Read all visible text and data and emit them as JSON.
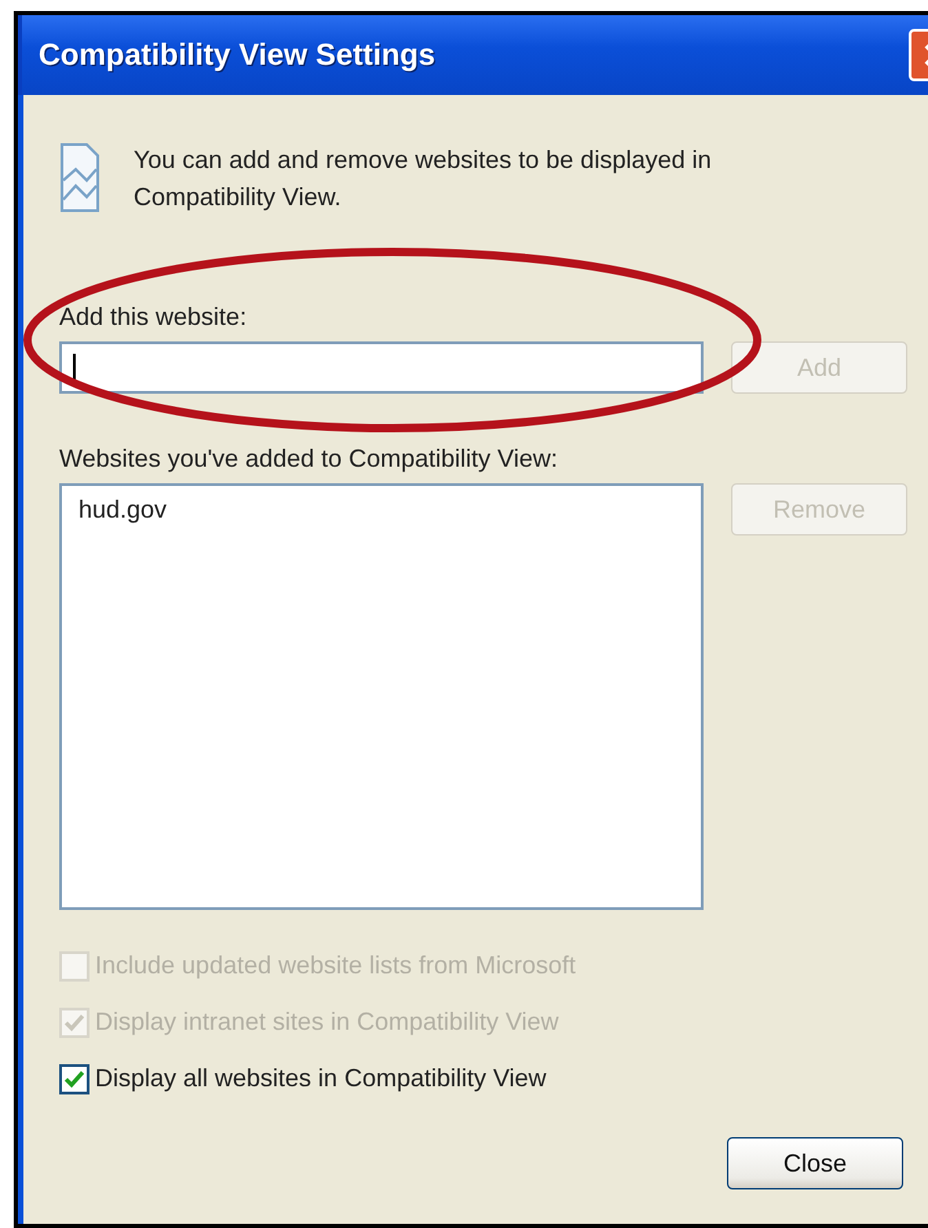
{
  "window": {
    "title": "Compatibility View Settings"
  },
  "intro": "You can add and remove websites to be displayed in Compatibility View.",
  "add_field": {
    "label": "Add this website:",
    "button": "Add",
    "button_disabled": true
  },
  "website_list": {
    "label": "Websites you've added to Compatibility View:",
    "items": [
      {
        "text": "hud.gov",
        "selected": false
      }
    ],
    "button": "Remove",
    "button_disabled": true
  },
  "options": [
    {
      "label": "Include updated website lists from Microsoft",
      "checked": false,
      "disabled": true
    },
    {
      "label": "Display intranet sites in Compatibility View",
      "checked": true,
      "disabled": true
    },
    {
      "label": "Display all websites in Compatibility View",
      "checked": true,
      "disabled": false
    }
  ],
  "close_button": "Close"
}
